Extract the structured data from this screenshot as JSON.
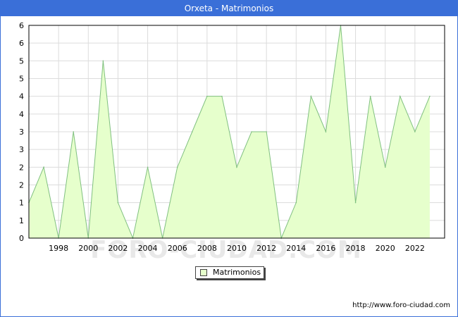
{
  "title": "Orxeta - Matrimonios",
  "source_url": "http://www.foro-ciudad.com",
  "watermark": "FORO-CIUDAD.COM",
  "colors": {
    "title_bar": "#3a6fd8",
    "area_fill": "#e6ffcc",
    "area_line": "#80c080",
    "grid": "#dcdcdc",
    "watermark": "#e8e8e8"
  },
  "chart_data": {
    "type": "area",
    "title": "Orxeta - Matrimonios",
    "xlabel": "",
    "ylabel": "",
    "xlim": [
      1996,
      2024
    ],
    "ylim": [
      0,
      6
    ],
    "x_ticks": [
      1998,
      2000,
      2002,
      2004,
      2006,
      2008,
      2010,
      2012,
      2014,
      2016,
      2018,
      2020,
      2022
    ],
    "y_ticks": [
      0,
      0.5,
      1,
      1.5,
      2,
      2.5,
      3,
      3.5,
      4,
      4.5,
      5,
      5.5,
      6
    ],
    "y_tick_labels": [
      "0",
      "1",
      "1",
      "2",
      "2",
      "3",
      "3",
      "4",
      "4",
      "5",
      "5",
      "6",
      "6"
    ],
    "grid": true,
    "legend": "bottom-center",
    "series": [
      {
        "name": "Matrimonios",
        "x": [
          1996,
          1997,
          1998,
          1999,
          2000,
          2001,
          2002,
          2003,
          2004,
          2005,
          2006,
          2007,
          2008,
          2009,
          2010,
          2011,
          2012,
          2013,
          2014,
          2015,
          2016,
          2017,
          2018,
          2019,
          2020,
          2021,
          2022,
          2023
        ],
        "values": [
          1,
          2,
          0,
          3,
          0,
          5,
          1,
          0,
          2,
          0,
          2,
          3,
          4,
          4,
          2,
          3,
          3,
          0,
          1,
          4,
          3,
          6,
          1,
          4,
          2,
          4,
          3,
          4
        ]
      }
    ]
  }
}
